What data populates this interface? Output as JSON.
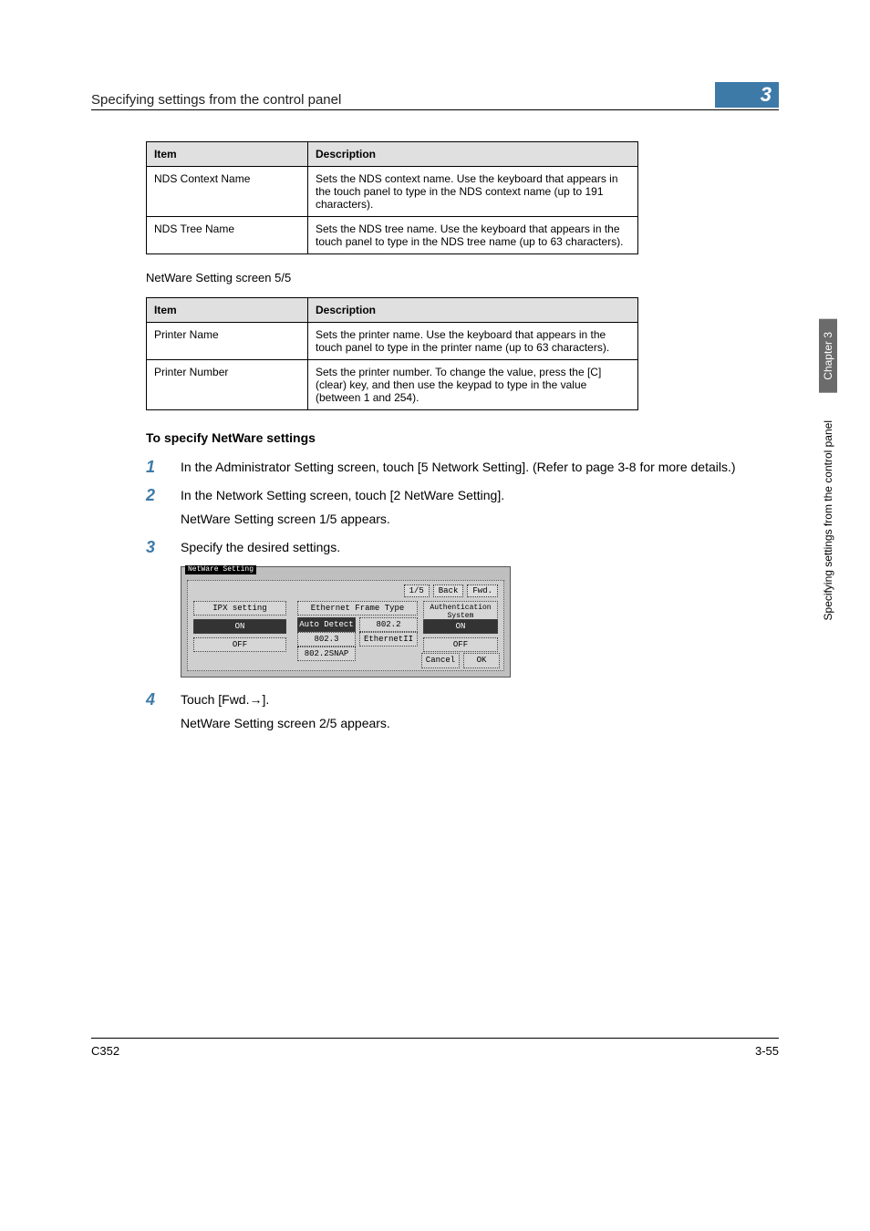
{
  "header": {
    "title": "Specifying settings from the control panel",
    "chapter_badge": "3"
  },
  "table1": {
    "col_item": "Item",
    "col_desc": "Description",
    "rows": [
      {
        "item": "NDS Context Name",
        "desc": "Sets the NDS context name. Use the keyboard that appears in the touch panel to type in the NDS context name (up to 191 characters)."
      },
      {
        "item": "NDS Tree Name",
        "desc": "Sets the NDS tree name. Use the keyboard that appears in the touch panel to type in the NDS tree name (up to 63 characters)."
      }
    ]
  },
  "label_5_5": "NetWare Setting screen 5/5",
  "table2": {
    "col_item": "Item",
    "col_desc": "Description",
    "rows": [
      {
        "item": "Printer Name",
        "desc": "Sets the printer name. Use the keyboard that appears in the touch panel to type in the printer name (up to 63 characters)."
      },
      {
        "item": "Printer Number",
        "desc": "Sets the printer number. To change the value, press the [C] (clear) key, and then use the keypad to type in the value (between 1 and 254)."
      }
    ]
  },
  "subheading": "To specify NetWare settings",
  "steps": {
    "s1": {
      "num": "1",
      "text": "In the Administrator Setting screen, touch [5 Network Setting]. (Refer to page 3-8 for more details.)"
    },
    "s2": {
      "num": "2",
      "text": "In the Network Setting screen, touch [2 NetWare Setting].",
      "sub": "NetWare Setting screen 1/5 appears."
    },
    "s3": {
      "num": "3",
      "text": "Specify the desired settings."
    },
    "s4": {
      "num": "4",
      "text": "Touch [Fwd.→].",
      "sub": "NetWare Setting screen 2/5 appears."
    }
  },
  "screenshot": {
    "title": "NetWare Setting",
    "page": "1/5",
    "back": "Back",
    "fwd": "Fwd.",
    "ipx_label": "IPX setting",
    "frame_label": "Ethernet Frame Type",
    "auth_label": "Authentication System",
    "on": "ON",
    "off": "OFF",
    "auto": "Auto Detect",
    "f802_2": "802.2",
    "f802_3": "802.3",
    "ethernetII": "EthernetII",
    "snap": "802.2SNAP",
    "cancel": "Cancel",
    "ok": "OK"
  },
  "sidebar": {
    "chapter": "Chapter 3",
    "label": "Specifying settings from the control panel"
  },
  "footer": {
    "left": "C352",
    "right": "3-55"
  }
}
